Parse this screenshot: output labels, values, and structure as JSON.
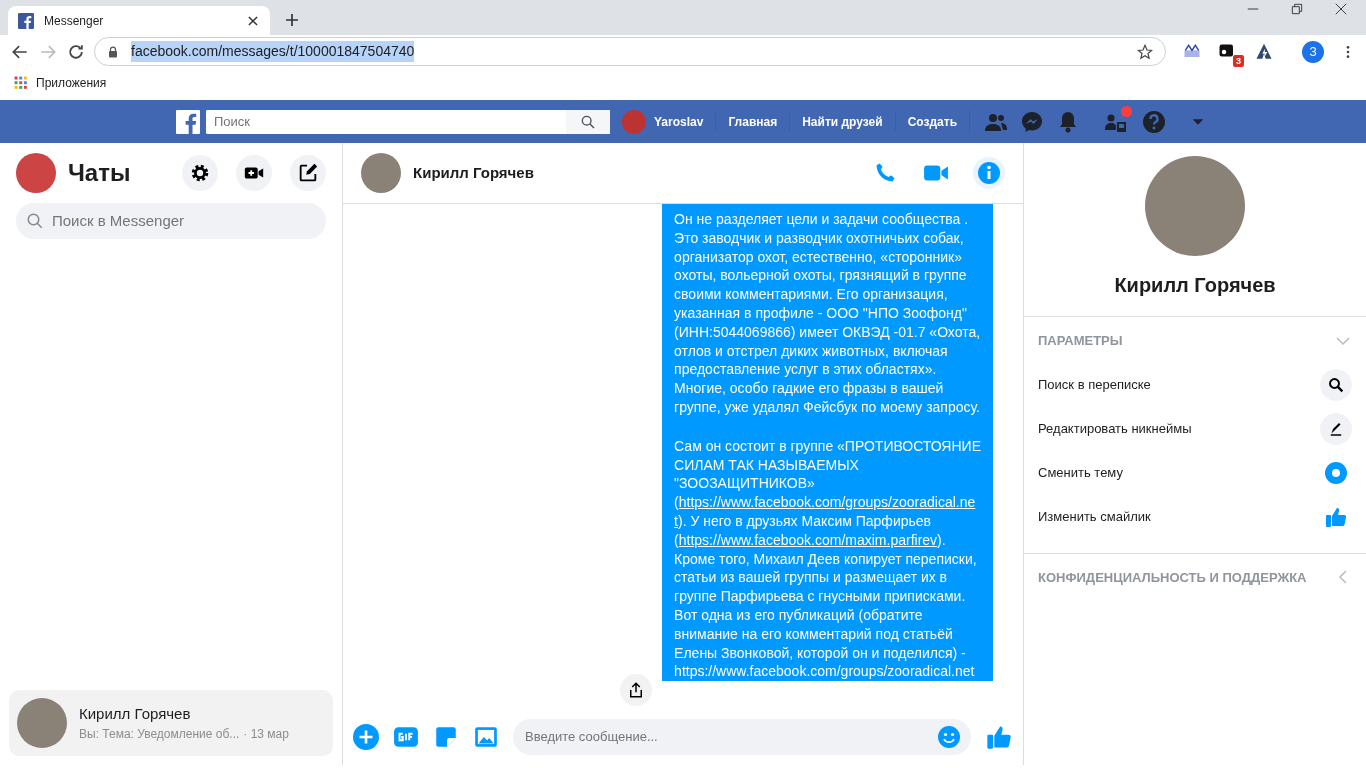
{
  "browser": {
    "tab_title": "Messenger",
    "url": "facebook.com/messages/t/100001847504740",
    "url_selected": true,
    "bookmarks": [
      "Приложения"
    ],
    "extension_badge": "3",
    "profile_initial": "З"
  },
  "fb_bar": {
    "search_placeholder": "Поиск",
    "user": "Yaroslav",
    "links": [
      "Главная",
      "Найти друзей",
      "Создать"
    ],
    "friend_requests_dot": true
  },
  "sidebar": {
    "title": "Чаты",
    "search_placeholder": "Поиск в Messenger",
    "chats": [
      {
        "name": "Кирилл Горячев",
        "preview": "Вы: Тема: Уведомление об...",
        "time": "· 13 мар",
        "selected": true
      }
    ]
  },
  "conversation": {
    "name": "Кирилл Горячев",
    "composer_placeholder": "Введите сообщение...",
    "message": {
      "paragraphs": [
        {
          "lines": [
            "Он не разделяет цели и задачи сообщества .",
            "Это заводчик и разводчик охотничьих собак,",
            "организатор охот, естественно, «сторонник»",
            "охоты, вольерной охоты, грязнящий в группе",
            "своими комментариями. Его организация,",
            "указанная в профиле - ООО \"НПО Зоофонд\"",
            "(ИНН:5044069866) имеет ОКВЭД -01.7 «Охота,",
            "отлов и отстрел диких животных, включая",
            "предоставление услуг в этих областях».",
            "Многие, особо гадкие его фразы в вашей",
            "группе, уже удалял Фейсбук по моему запросу."
          ]
        },
        {
          "lines": [
            "Сам он состоит в группе «ПРОТИВОСТОЯНИЕ",
            "СИЛАМ ТАК НАЗЫВАЕМЫХ",
            "\"ЗООЗАЩИТНИКОВ»",
            [
              {
                "kind": "text",
                "text": "("
              },
              {
                "kind": "link",
                "text": "https://www.facebook.com/groups/zooradical.ne"
              }
            ],
            [
              {
                "kind": "link",
                "text": "t"
              },
              {
                "kind": "text",
                "text": "). У него в друзьях Максим Парфирьев"
              }
            ],
            [
              {
                "kind": "text",
                "text": "("
              },
              {
                "kind": "link",
                "text": "https://www.facebook.com/maxim.parfirev"
              },
              {
                "kind": "text",
                "text": ")."
              }
            ],
            "Кроме того, Михаил Деев копирует переписки,",
            "статьи из вашей группы и размещает их в",
            "группе Парфирьева с гнусными приписками.",
            "Вот одна из его публикаций (обратите",
            "внимание на его комментарий под статьёй",
            "Елены Звонковой, которой он и поделился) -",
            "https://www.facebook.com/groups/zooradical.net"
          ]
        }
      ]
    }
  },
  "info_panel": {
    "name": "Кирилл Горячев",
    "sections": [
      {
        "title": "ПАРАМЕТРЫ",
        "expanded": true,
        "items": [
          {
            "label": "Поиск в переписке",
            "kind": "search"
          },
          {
            "label": "Редактировать никнеймы",
            "kind": "nickname"
          },
          {
            "label": "Сменить тему",
            "kind": "theme"
          },
          {
            "label": "Изменить смайлик",
            "kind": "emoji"
          }
        ]
      },
      {
        "title": "КОНФИДЕНЦИАЛЬНОСТЬ И ПОДДЕРЖКА",
        "expanded": false
      }
    ]
  }
}
